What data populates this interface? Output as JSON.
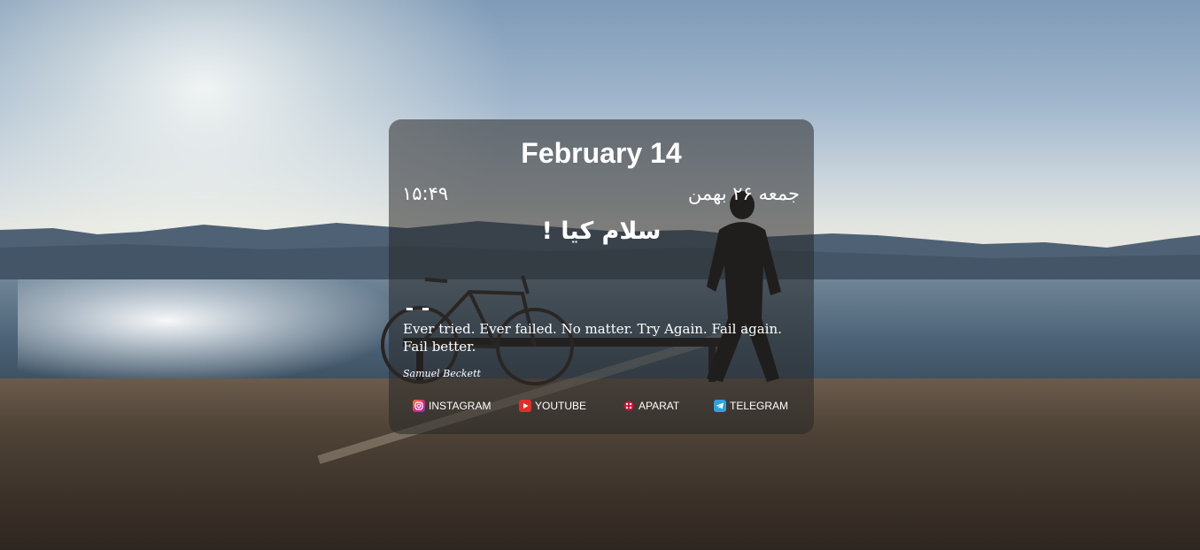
{
  "header": {
    "date_gregorian": "February 14",
    "date_persian": "جمعه ۲۶ بهمن",
    "time": "۱۵:۴۹"
  },
  "greeting": "سلام کیا !",
  "quote": {
    "mark": ",,",
    "text": "Ever tried. Ever failed. No matter. Try Again. Fail again. Fail better.",
    "author": "Samuel Beckett"
  },
  "links": [
    {
      "label": "INSTAGRAM",
      "icon": "instagram-icon",
      "color": "#e1306c"
    },
    {
      "label": "YOUTUBE",
      "icon": "youtube-icon",
      "color": "#e52d27"
    },
    {
      "label": "APARAT",
      "icon": "aparat-icon",
      "color": "#d1103a"
    },
    {
      "label": "TELEGRAM",
      "icon": "telegram-icon",
      "color": "#2aa3df"
    }
  ]
}
